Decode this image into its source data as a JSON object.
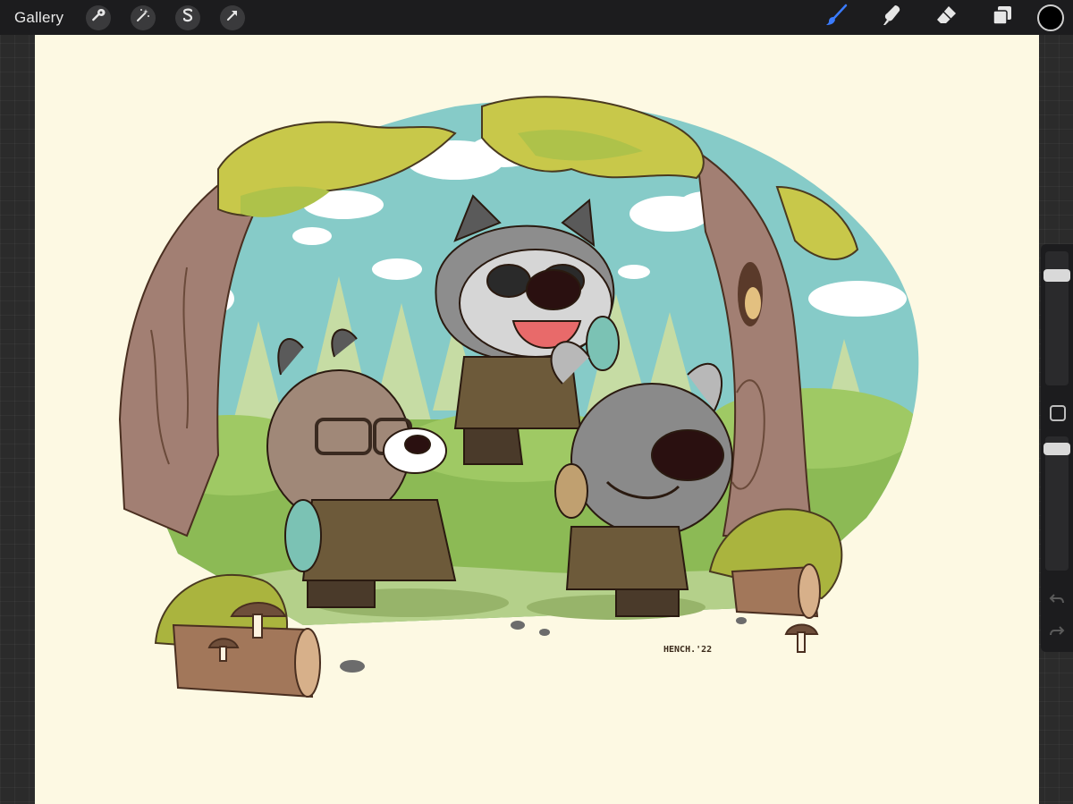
{
  "toolbar": {
    "gallery_label": "Gallery",
    "left_tools": [
      "wrench-icon",
      "magic-wand-icon",
      "selection-icon",
      "transform-arrow-icon"
    ],
    "right_tools": [
      "brush-icon",
      "smudge-icon",
      "eraser-icon",
      "layers-icon"
    ],
    "active_tool": "brush-icon",
    "active_color": "#000000",
    "accent_color": "#3a7bff"
  },
  "artwork": {
    "signature": "HENCH.'22"
  },
  "sidebar": {
    "brush_size": 0.85,
    "opacity": 0.95,
    "controls": [
      "brush-size-slider",
      "modify-button",
      "opacity-slider",
      "undo-icon",
      "redo-icon"
    ]
  }
}
